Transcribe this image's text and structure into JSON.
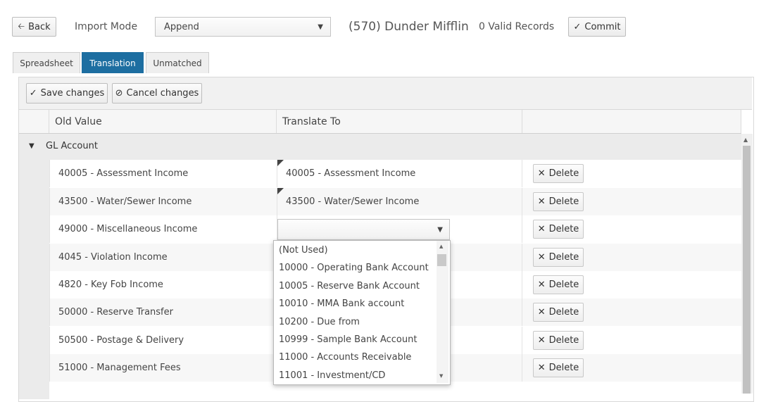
{
  "top": {
    "back_label": "Back",
    "import_mode_label": "Import Mode",
    "import_mode_value": "Append",
    "company": "(570) Dunder Mifflin",
    "valid_records": "0 Valid Records",
    "commit_label": "Commit"
  },
  "tabs": [
    "Spreadsheet",
    "Translation",
    "Unmatched"
  ],
  "toolbar": {
    "save_label": "Save changes",
    "cancel_label": "Cancel changes"
  },
  "columns": {
    "old_value": "Old Value",
    "translate_to": "Translate To"
  },
  "group": {
    "label": "GL Account"
  },
  "rows": [
    {
      "old": "40005 - Assessment Income",
      "new": "40005 - Assessment Income",
      "delete": "Delete"
    },
    {
      "old": "43500 - Water/Sewer Income",
      "new": "43500 - Water/Sewer Income",
      "delete": "Delete"
    },
    {
      "old": "49000 - Miscellaneous Income",
      "new": "",
      "delete": "Delete"
    },
    {
      "old": "4045 - Violation Income",
      "new": "",
      "delete": "Delete"
    },
    {
      "old": "4820 - Key Fob Income",
      "new": "",
      "delete": "Delete"
    },
    {
      "old": "50000 - Reserve Transfer",
      "new": "",
      "delete": "Delete"
    },
    {
      "old": "50500 - Postage & Delivery",
      "new": "",
      "delete": "Delete"
    },
    {
      "old": "51000 - Management Fees",
      "new": "",
      "delete": "Delete"
    }
  ],
  "dropdown_options": [
    "(Not Used)",
    "10000 - Operating Bank Account",
    "10005 - Reserve Bank Account",
    "10010 - MMA Bank account",
    "10200 - Due from",
    "10999 - Sample Bank Account",
    "11000 - Accounts Receivable",
    "11001 - Investment/CD"
  ],
  "icons": {
    "back": "arrow-left-icon",
    "commit": "check-icon",
    "save": "check-icon",
    "cancel": "ban-icon",
    "delete": "x-icon",
    "group": "caret-down-icon"
  },
  "colors": {
    "active_tab": "#1d6ea1"
  }
}
